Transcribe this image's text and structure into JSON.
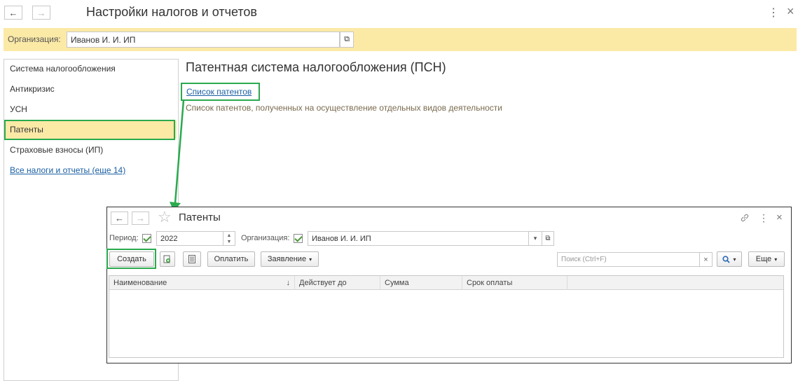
{
  "main": {
    "title": "Настройки налогов и отчетов",
    "nav": {
      "back": "←",
      "forward": "→"
    },
    "menu_icon": "⋮",
    "close_icon": "×",
    "org_label": "Организация:",
    "org_value": "Иванов И. И. ИП",
    "open_icon": "⧉",
    "sidebar": {
      "items": [
        {
          "label": "Система налогообложения"
        },
        {
          "label": "Антикризис"
        },
        {
          "label": "УСН"
        },
        {
          "label": "Патенты"
        },
        {
          "label": "Страховые взносы (ИП)"
        }
      ],
      "all_link": "Все налоги и отчеты (еще 14)"
    },
    "section": {
      "heading": "Патентная система налогообложения (ПСН)",
      "link": "Список патентов",
      "description": "Список патентов, полученных на осуществление отдельных видов деятельности"
    }
  },
  "popup": {
    "nav": {
      "back": "←",
      "forward": "→"
    },
    "star_icon": "☆",
    "title": "Патенты",
    "link_icon": "🔗",
    "menu_icon": "⋮",
    "close_icon": "×",
    "period_label": "Период:",
    "period_value": "2022",
    "org_label": "Организация:",
    "org_value": "Иванов И. И. ИП",
    "dropdown_icon": "▾",
    "open_icon": "⧉",
    "toolbar": {
      "create": "Создать",
      "pay": "Оплатить",
      "statement": "Заявление",
      "search_placeholder": "Поиск (Ctrl+F)",
      "clear_icon": "×",
      "more": "Еще"
    },
    "table": {
      "columns": [
        "Наименование",
        "Действует до",
        "Сумма",
        "Срок оплаты"
      ],
      "sort_icon": "↓"
    }
  },
  "colors": {
    "accent_yellow": "#fbe9a6",
    "highlight_green": "#2aaa4e",
    "link_blue": "#1b5fa3",
    "description_brown": "#7a6a4f"
  }
}
